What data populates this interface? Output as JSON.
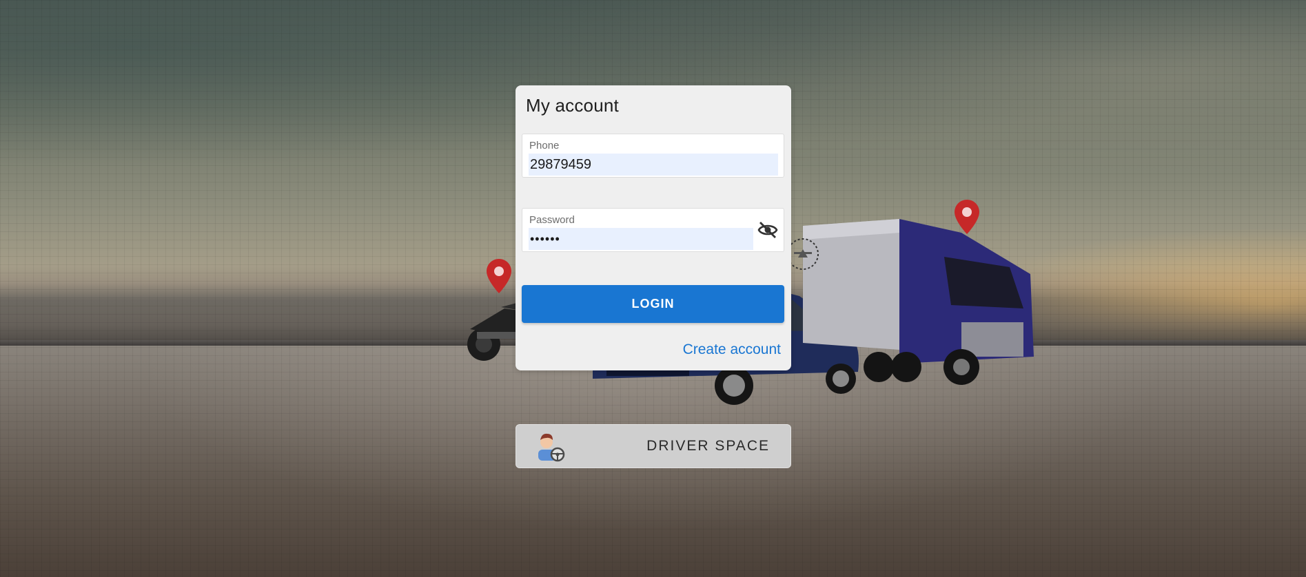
{
  "login_card": {
    "title": "My account",
    "phone_label": "Phone",
    "phone_value": "29879459",
    "password_label": "Password",
    "password_value": "••••••",
    "login_button": "LOGIN",
    "create_account_link": "Create account",
    "password_toggle_icon": "eye-off-icon"
  },
  "driver_space": {
    "label": "DRIVER SPACE",
    "icon": "driver-steering-wheel-icon"
  },
  "colors": {
    "primary": "#1976d2",
    "card_background": "#efefef",
    "input_autofill": "#e8f0fe",
    "driver_button_background": "#cfcfcf"
  }
}
